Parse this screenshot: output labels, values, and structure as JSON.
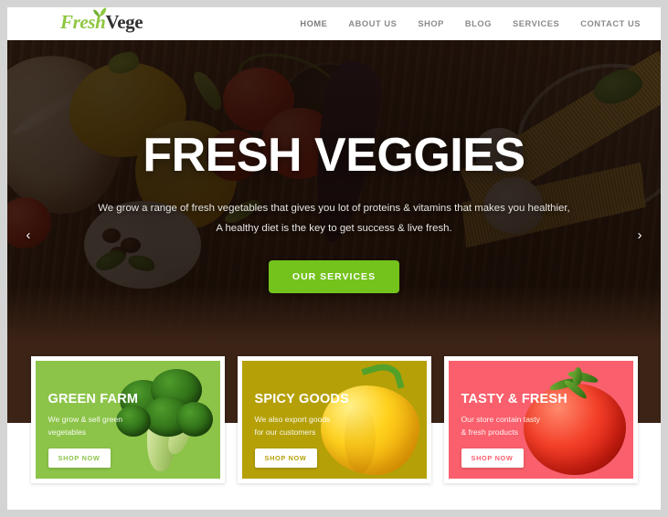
{
  "header": {
    "logo": {
      "part1": "Fresh",
      "part2": "Vege",
      "leaf_icon": "leaf-icon"
    },
    "nav": [
      {
        "label": "HOME",
        "active": true
      },
      {
        "label": "ABOUT US",
        "active": false
      },
      {
        "label": "SHOP",
        "active": false
      },
      {
        "label": "BLOG",
        "active": false
      },
      {
        "label": "SERVICES",
        "active": false
      },
      {
        "label": "CONTACT US",
        "active": false
      }
    ]
  },
  "hero": {
    "title": "FRESH VEGGIES",
    "subtitle_line1": "We grow a range of fresh vegetables that gives you lot of proteins & vitamins that makes you healthier,",
    "subtitle_line2": "A healthy diet is the key to get success & live fresh.",
    "cta_label": "OUR SERVICES",
    "cta_color": "#74c31c",
    "prev_arrow": "‹",
    "next_arrow": "›",
    "prev_icon": "chevron-left-icon",
    "next_icon": "chevron-right-icon"
  },
  "cards": [
    {
      "title": "GREEN FARM",
      "desc_line1": "We grow & sell green",
      "desc_line2": "vegetables",
      "button_label": "SHOP NOW",
      "bg_color": "#8cc449",
      "text_color": "#8cc449",
      "image": "broccoli-image"
    },
    {
      "title": "SPICY GOODS",
      "desc_line1": "We also export goods",
      "desc_line2": "for our customers",
      "button_label": "SHOP NOW",
      "bg_color": "#b5a007",
      "text_color": "#b5a007",
      "image": "yellow-pepper-image"
    },
    {
      "title": "TASTY & FRESH",
      "desc_line1": "Our store contain tasty",
      "desc_line2": "& fresh products",
      "button_label": "SHOP NOW",
      "bg_color": "#f95f6c",
      "text_color": "#f95f6c",
      "image": "tomato-image"
    }
  ]
}
